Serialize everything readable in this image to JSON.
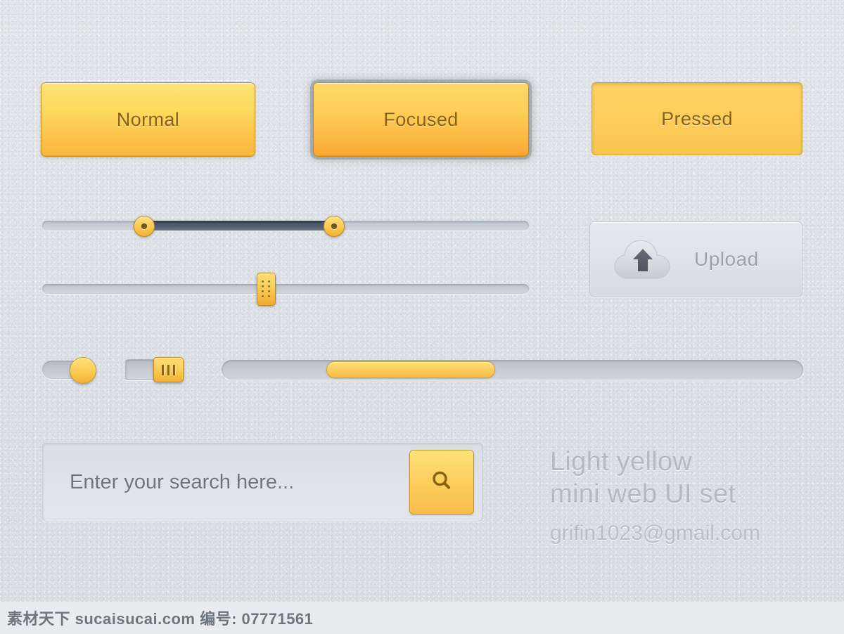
{
  "buttons": [
    {
      "name": "normal",
      "label": "Normal"
    },
    {
      "name": "focused",
      "label": "Focused"
    },
    {
      "name": "pressed",
      "label": "Pressed"
    }
  ],
  "range_slider": {
    "label": "range-slider",
    "min": 0,
    "max": 100,
    "low_value": 21,
    "high_value": 60,
    "track_color": "#c6ccd2",
    "fill_color": "#4e5a6b",
    "knob_color": "#fbcb55"
  },
  "single_slider": {
    "label": "single-slider",
    "min": 0,
    "max": 100,
    "value": 46,
    "track_color": "#c6ccd2",
    "knob_color": "#fbc94f"
  },
  "upload": {
    "label": "Upload",
    "icon": "cloud-upload-icon",
    "text_color": "#9ba2ab"
  },
  "toggle_pill": {
    "label": "toggle-pill",
    "state": "on",
    "knob_color": "#fbcb54",
    "track_color": "#c3c9cf"
  },
  "toggle_square": {
    "label": "toggle-square",
    "state": "on",
    "icon": "grip-lines-icon",
    "knob_color": "#fbca52",
    "track_color": "#c5cbd1"
  },
  "progress": {
    "label": "progress-bar",
    "start_percent": 18,
    "end_percent": 47,
    "value_percent": 29,
    "fill_color": "#fccd5c",
    "track_color": "#c5cbd1"
  },
  "search": {
    "value": "",
    "placeholder": "Enter your search here...",
    "button_icon": "search-icon",
    "button_color": "#fccf5d"
  },
  "info": {
    "title_line1": "Light yellow",
    "title_line2": "mini web UI set",
    "email": "grifin1023@gmail.com"
  },
  "watermark": {
    "text": "素材天下 sucaisucai.com  编号: 07771561"
  },
  "theme": {
    "background": "#dfe3e7",
    "accent": "#fbc94f",
    "accent_dark": "#f2ad31",
    "text_muted": "#9ba2ab"
  }
}
